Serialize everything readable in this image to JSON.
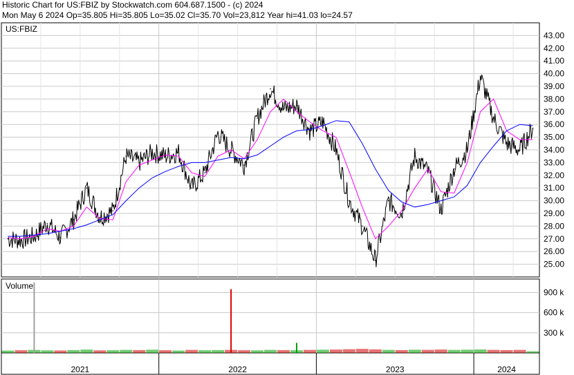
{
  "header": {
    "line1": "Historic Chart for US:FBIZ by Stockwatch.com 604.687.1500 - (c) 2024",
    "line2": "Mon May  6 2024   Op=35.805   Hi=35.805   Lo=35.02   Cl=35.70   Vol=23,812   Year hi=41.03   lo=24.57"
  },
  "colors": {
    "price": "#000000",
    "ma_short": "#ff00ff",
    "ma_long": "#0000ff",
    "grid": "#c8c8c8",
    "volume_up": "#00a000",
    "volume_down": "#d00000",
    "volume_spike_2021": "#a0a0a0",
    "volume_spike_2022": "#e00000"
  },
  "chart_data": [
    {
      "type": "line",
      "symbol_label": "US:FBIZ",
      "ylim": [
        24,
        44
      ],
      "y_ticks": [
        "43.00",
        "42.00",
        "41.00",
        "40.00",
        "39.00",
        "38.00",
        "37.00",
        "36.00",
        "35.00",
        "34.00",
        "33.00",
        "32.00",
        "31.00",
        "30.00",
        "29.00",
        "28.00",
        "27.00",
        "26.00",
        "25.00"
      ],
      "x_labels": [
        "2021",
        "2022",
        "2023",
        "2024"
      ],
      "grid": true,
      "series": [
        {
          "key": "price",
          "x": [
            "2021-01",
            "2021-02",
            "2021-03",
            "2021-04",
            "2021-05",
            "2021-06",
            "2021-07",
            "2021-08",
            "2021-09",
            "2021-10",
            "2021-11",
            "2021-12",
            "2022-01",
            "2022-02",
            "2022-03",
            "2022-04",
            "2022-05",
            "2022-06",
            "2022-07",
            "2022-08",
            "2022-09",
            "2022-10",
            "2022-11",
            "2022-12",
            "2023-01",
            "2023-02",
            "2023-03",
            "2023-04",
            "2023-05",
            "2023-06",
            "2023-07",
            "2023-08",
            "2023-09",
            "2023-10",
            "2023-11",
            "2023-12",
            "2024-01",
            "2024-02",
            "2024-03",
            "2024-04",
            "2024-05"
          ],
          "values": [
            27.0,
            26.9,
            27.2,
            28.2,
            27.1,
            28.5,
            31.0,
            28.7,
            29.2,
            33.5,
            33.0,
            33.8,
            33.5,
            33.8,
            31.0,
            32.2,
            35.3,
            34.0,
            32.8,
            36.5,
            38.8,
            37.2,
            37.5,
            35.5,
            36.2,
            34.0,
            30.0,
            28.0,
            25.3,
            30.0,
            29.0,
            33.5,
            32.3,
            29.3,
            32.5,
            34.0,
            39.8,
            36.5,
            34.5,
            34.0,
            35.7
          ]
        },
        {
          "key": "ma_short",
          "x": [
            "2021-01",
            "2021-02",
            "2021-03",
            "2021-04",
            "2021-05",
            "2021-06",
            "2021-07",
            "2021-08",
            "2021-09",
            "2021-10",
            "2021-11",
            "2021-12",
            "2022-01",
            "2022-02",
            "2022-03",
            "2022-04",
            "2022-05",
            "2022-06",
            "2022-07",
            "2022-08",
            "2022-09",
            "2022-10",
            "2022-11",
            "2022-12",
            "2023-01",
            "2023-02",
            "2023-03",
            "2023-04",
            "2023-05",
            "2023-06",
            "2023-07",
            "2023-08",
            "2023-09",
            "2023-10",
            "2023-11",
            "2023-12",
            "2024-01",
            "2024-02",
            "2024-03",
            "2024-04",
            "2024-05"
          ],
          "values": [
            27.1,
            27.0,
            27.2,
            27.8,
            27.6,
            28.0,
            29.5,
            28.6,
            28.5,
            31.5,
            32.8,
            33.2,
            33.6,
            33.5,
            32.2,
            31.9,
            33.5,
            34.0,
            33.3,
            34.8,
            37.0,
            38.0,
            37.0,
            36.2,
            35.5,
            35.0,
            32.3,
            29.5,
            27.0,
            28.0,
            29.2,
            31.0,
            32.5,
            30.7,
            30.6,
            33.0,
            37.0,
            38.0,
            35.5,
            34.8,
            34.8
          ]
        },
        {
          "key": "ma_long",
          "x": [
            "2021-01",
            "2021-02",
            "2021-03",
            "2021-04",
            "2021-05",
            "2021-06",
            "2021-07",
            "2021-08",
            "2021-09",
            "2021-10",
            "2021-11",
            "2021-12",
            "2022-01",
            "2022-02",
            "2022-03",
            "2022-04",
            "2022-05",
            "2022-06",
            "2022-07",
            "2022-08",
            "2022-09",
            "2022-10",
            "2022-11",
            "2022-12",
            "2023-01",
            "2023-02",
            "2023-03",
            "2023-04",
            "2023-05",
            "2023-06",
            "2023-07",
            "2023-08",
            "2023-09",
            "2023-10",
            "2023-11",
            "2023-12",
            "2024-01",
            "2024-02",
            "2024-03",
            "2024-04",
            "2024-05"
          ],
          "values": [
            27.2,
            27.2,
            27.3,
            27.4,
            27.6,
            27.8,
            28.1,
            28.5,
            28.9,
            30.0,
            31.0,
            31.8,
            32.3,
            32.7,
            33.0,
            33.0,
            33.2,
            33.4,
            33.3,
            33.6,
            34.3,
            35.0,
            35.5,
            35.6,
            35.9,
            36.3,
            36.2,
            34.5,
            32.5,
            30.8,
            29.9,
            29.5,
            29.7,
            30.0,
            30.3,
            31.2,
            33.0,
            34.3,
            35.5,
            36.0,
            35.9
          ]
        }
      ]
    },
    {
      "type": "bar",
      "title": "Volume",
      "ylim": [
        0,
        1100000
      ],
      "y_ticks": [
        "900 k",
        "600 k",
        "300 k"
      ],
      "x": [
        "2021-01",
        "2021-02",
        "2021-03",
        "2021-04",
        "2021-05",
        "2021-06",
        "2021-07",
        "2021-08",
        "2021-09",
        "2021-10",
        "2021-11",
        "2021-12",
        "2022-01",
        "2022-02",
        "2022-03",
        "2022-04",
        "2022-05",
        "2022-06",
        "2022-07",
        "2022-08",
        "2022-09",
        "2022-10",
        "2022-11",
        "2022-12",
        "2023-01",
        "2023-02",
        "2023-03",
        "2023-04",
        "2023-05",
        "2023-06",
        "2023-07",
        "2023-08",
        "2023-09",
        "2023-10",
        "2023-11",
        "2023-12",
        "2024-01",
        "2024-02",
        "2024-03",
        "2024-04",
        "2024-05"
      ],
      "values": [
        35000,
        40000,
        45000,
        38000,
        36000,
        42000,
        50000,
        38000,
        40000,
        45000,
        42000,
        48000,
        40000,
        35000,
        45000,
        40000,
        42000,
        45000,
        40000,
        38000,
        45000,
        42000,
        40000,
        45000,
        48000,
        50000,
        55000,
        60000,
        52000,
        45000,
        42000,
        48000,
        45000,
        50000,
        45000,
        48000,
        52000,
        45000,
        42000,
        45000,
        24000
      ],
      "spikes": [
        {
          "x": "2021-03",
          "value": 1050000
        },
        {
          "x": "2022-06",
          "value": 950000
        },
        {
          "x": "2022-11",
          "value": 150000
        }
      ]
    }
  ]
}
